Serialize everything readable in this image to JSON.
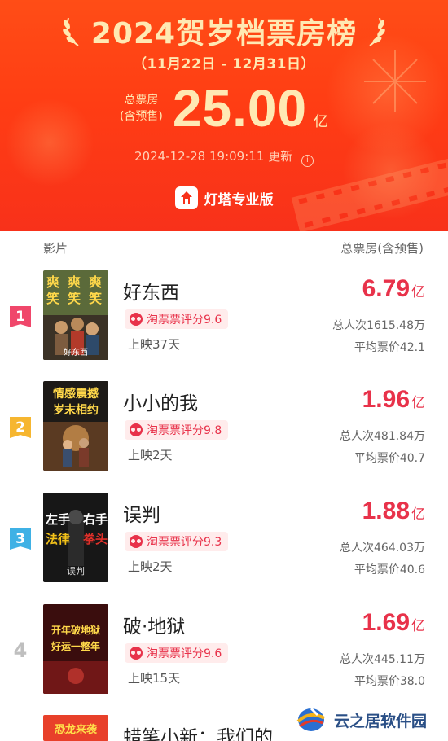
{
  "header": {
    "title": "2024贺岁档票房榜",
    "date_range": "（11月22日 - 12月31日）",
    "total_label_line1": "总票房",
    "total_label_line2": "(含预售)",
    "total_value": "25.00",
    "total_unit": "亿",
    "update_time": "2024-12-28 19:09:11",
    "update_suffix": "更新",
    "brand": "灯塔专业版"
  },
  "columns": {
    "left": "影片",
    "right": "总票房(含预售)"
  },
  "movies": [
    {
      "rank": "1",
      "title": "好东西",
      "rating": "淘票票评分9.6",
      "days": "上映37天",
      "box_office": "6.79",
      "unit": "亿",
      "persons": "总人次1615.48万",
      "avg_price": "平均票价42.1",
      "poster_text": [
        "爽",
        "爽",
        "爽",
        "笑",
        "笑",
        "笑"
      ],
      "poster_caption": "好东西"
    },
    {
      "rank": "2",
      "title": "小小的我",
      "rating": "淘票票评分9.8",
      "days": "上映2天",
      "box_office": "1.96",
      "unit": "亿",
      "persons": "总人次481.84万",
      "avg_price": "平均票价40.7",
      "poster_text": [
        "情感震撼",
        "岁末相约"
      ]
    },
    {
      "rank": "3",
      "title": "误判",
      "rating": "淘票票评分9.3",
      "days": "上映2天",
      "box_office": "1.88",
      "unit": "亿",
      "persons": "总人次464.03万",
      "avg_price": "平均票价40.6",
      "poster_text": [
        "左手",
        "法律",
        "右手",
        "拳头",
        "误判"
      ]
    },
    {
      "rank": "4",
      "title": "破·地狱",
      "rating": "淘票票评分9.6",
      "days": "上映15天",
      "box_office": "1.69",
      "unit": "亿",
      "persons": "总人次445.11万",
      "avg_price": "平均票价38.0",
      "poster_text": [
        "开年破地狱",
        "好运一整年"
      ]
    },
    {
      "title": "蜡笔小新：我们的",
      "poster_text": [
        "恐龙来袭"
      ]
    }
  ],
  "rank_colors": [
    "#f0476b",
    "#f6b630",
    "#3fb1e5"
  ],
  "accent": "#e8324a",
  "watermark": "云之居软件园"
}
